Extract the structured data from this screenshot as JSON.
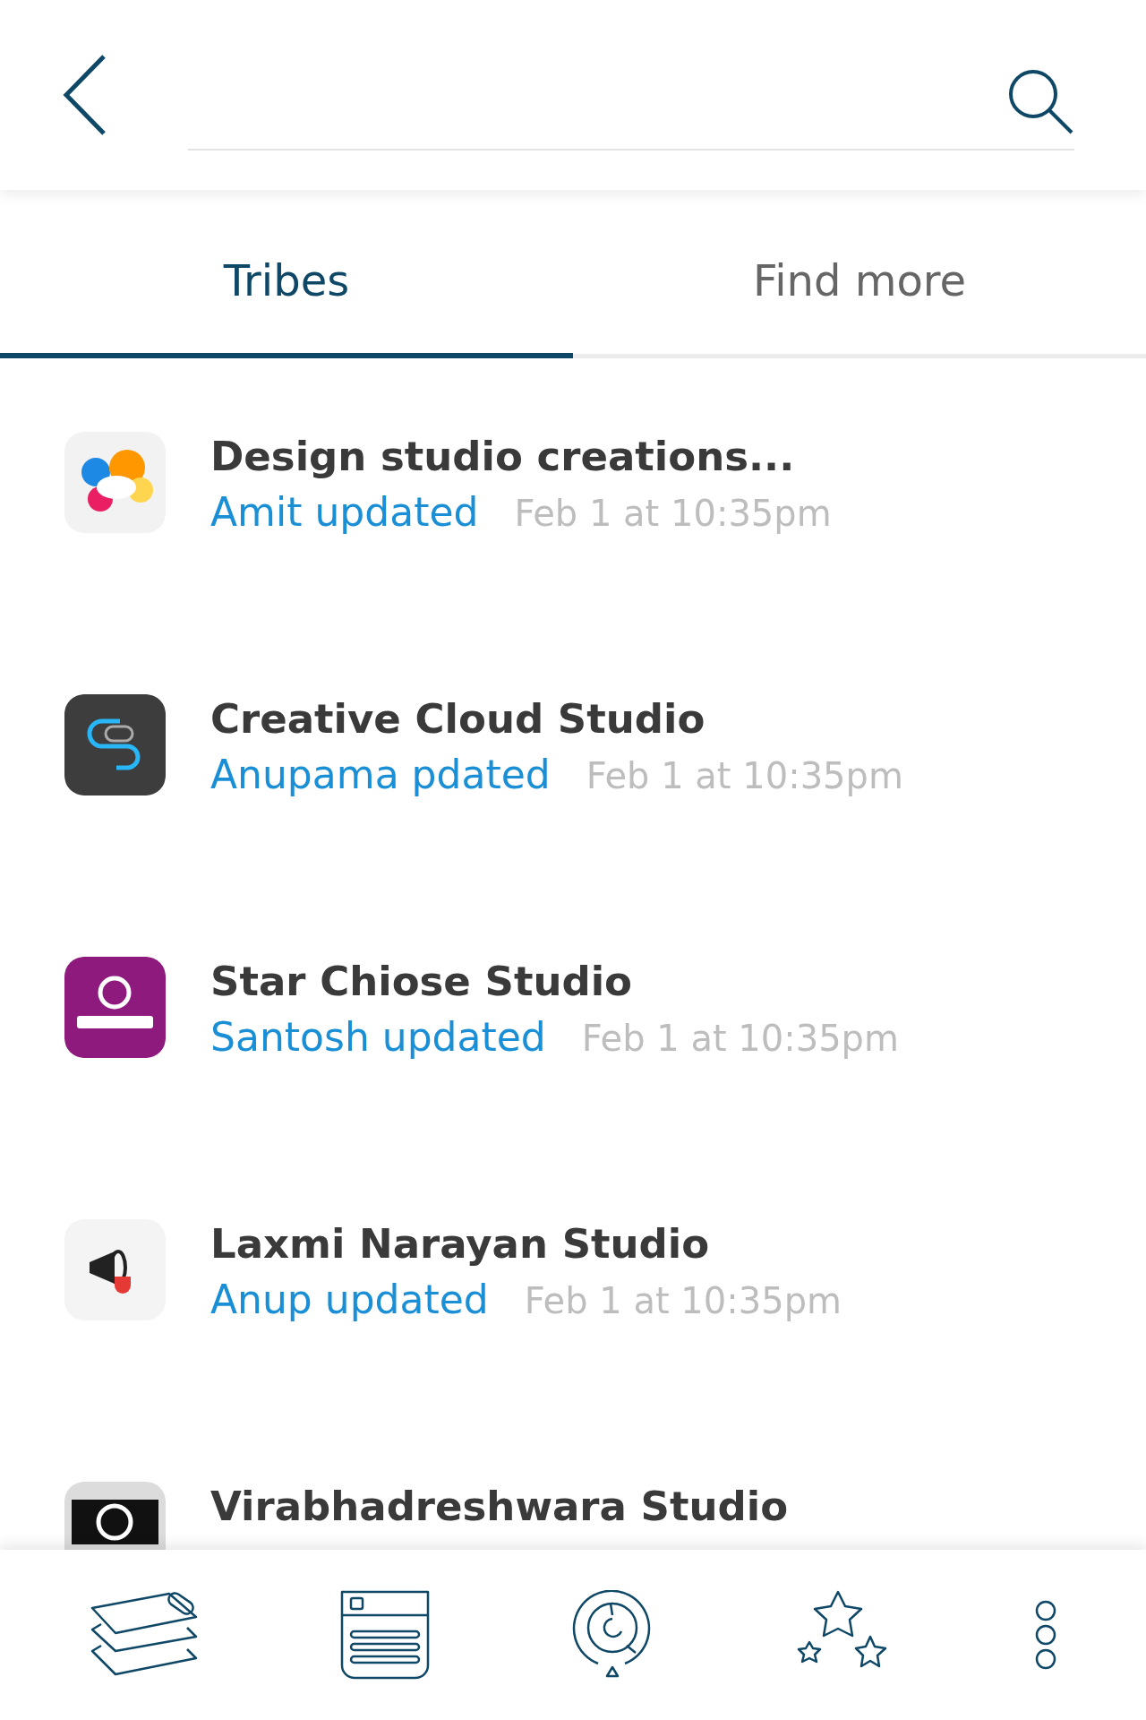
{
  "tabs": [
    {
      "label": "Tribes",
      "selected": true
    },
    {
      "label": "Find more",
      "selected": false
    }
  ],
  "tribes": [
    {
      "name": "Design studio creations...",
      "updater": "Amit updated",
      "time": "Feb 1 at 10:35pm"
    },
    {
      "name": "Creative Cloud Studio",
      "updater": "Anupama pdated",
      "time": "Feb 1 at 10:35pm"
    },
    {
      "name": "Star Chiose Studio",
      "updater": "Santosh updated",
      "time": "Feb 1 at 10:35pm"
    },
    {
      "name": "Laxmi Narayan Studio",
      "updater": "Anup updated",
      "time": "Feb 1 at 10:35pm"
    },
    {
      "name": "Virabhadreshwara Studio"
    }
  ]
}
